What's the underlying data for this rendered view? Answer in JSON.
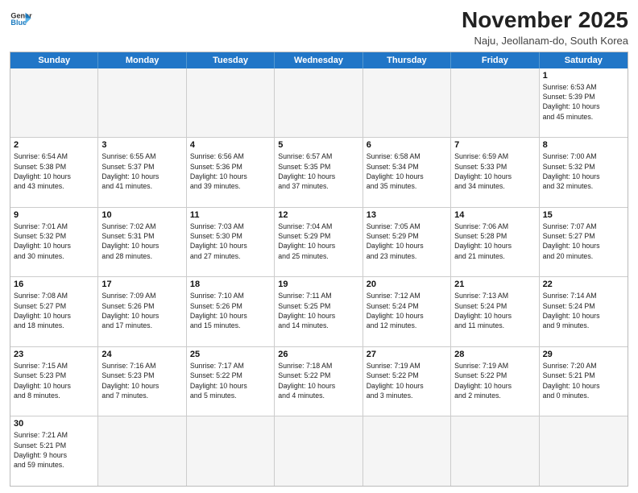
{
  "logo": {
    "line1": "General",
    "line2": "Blue"
  },
  "title": "November 2025",
  "subtitle": "Naju, Jeollanam-do, South Korea",
  "weekdays": [
    "Sunday",
    "Monday",
    "Tuesday",
    "Wednesday",
    "Thursday",
    "Friday",
    "Saturday"
  ],
  "weeks": [
    [
      {
        "day": "",
        "info": ""
      },
      {
        "day": "",
        "info": ""
      },
      {
        "day": "",
        "info": ""
      },
      {
        "day": "",
        "info": ""
      },
      {
        "day": "",
        "info": ""
      },
      {
        "day": "",
        "info": ""
      },
      {
        "day": "1",
        "info": "Sunrise: 6:53 AM\nSunset: 5:39 PM\nDaylight: 10 hours\nand 45 minutes."
      }
    ],
    [
      {
        "day": "2",
        "info": "Sunrise: 6:54 AM\nSunset: 5:38 PM\nDaylight: 10 hours\nand 43 minutes."
      },
      {
        "day": "3",
        "info": "Sunrise: 6:55 AM\nSunset: 5:37 PM\nDaylight: 10 hours\nand 41 minutes."
      },
      {
        "day": "4",
        "info": "Sunrise: 6:56 AM\nSunset: 5:36 PM\nDaylight: 10 hours\nand 39 minutes."
      },
      {
        "day": "5",
        "info": "Sunrise: 6:57 AM\nSunset: 5:35 PM\nDaylight: 10 hours\nand 37 minutes."
      },
      {
        "day": "6",
        "info": "Sunrise: 6:58 AM\nSunset: 5:34 PM\nDaylight: 10 hours\nand 35 minutes."
      },
      {
        "day": "7",
        "info": "Sunrise: 6:59 AM\nSunset: 5:33 PM\nDaylight: 10 hours\nand 34 minutes."
      },
      {
        "day": "8",
        "info": "Sunrise: 7:00 AM\nSunset: 5:32 PM\nDaylight: 10 hours\nand 32 minutes."
      }
    ],
    [
      {
        "day": "9",
        "info": "Sunrise: 7:01 AM\nSunset: 5:32 PM\nDaylight: 10 hours\nand 30 minutes."
      },
      {
        "day": "10",
        "info": "Sunrise: 7:02 AM\nSunset: 5:31 PM\nDaylight: 10 hours\nand 28 minutes."
      },
      {
        "day": "11",
        "info": "Sunrise: 7:03 AM\nSunset: 5:30 PM\nDaylight: 10 hours\nand 27 minutes."
      },
      {
        "day": "12",
        "info": "Sunrise: 7:04 AM\nSunset: 5:29 PM\nDaylight: 10 hours\nand 25 minutes."
      },
      {
        "day": "13",
        "info": "Sunrise: 7:05 AM\nSunset: 5:29 PM\nDaylight: 10 hours\nand 23 minutes."
      },
      {
        "day": "14",
        "info": "Sunrise: 7:06 AM\nSunset: 5:28 PM\nDaylight: 10 hours\nand 21 minutes."
      },
      {
        "day": "15",
        "info": "Sunrise: 7:07 AM\nSunset: 5:27 PM\nDaylight: 10 hours\nand 20 minutes."
      }
    ],
    [
      {
        "day": "16",
        "info": "Sunrise: 7:08 AM\nSunset: 5:27 PM\nDaylight: 10 hours\nand 18 minutes."
      },
      {
        "day": "17",
        "info": "Sunrise: 7:09 AM\nSunset: 5:26 PM\nDaylight: 10 hours\nand 17 minutes."
      },
      {
        "day": "18",
        "info": "Sunrise: 7:10 AM\nSunset: 5:26 PM\nDaylight: 10 hours\nand 15 minutes."
      },
      {
        "day": "19",
        "info": "Sunrise: 7:11 AM\nSunset: 5:25 PM\nDaylight: 10 hours\nand 14 minutes."
      },
      {
        "day": "20",
        "info": "Sunrise: 7:12 AM\nSunset: 5:24 PM\nDaylight: 10 hours\nand 12 minutes."
      },
      {
        "day": "21",
        "info": "Sunrise: 7:13 AM\nSunset: 5:24 PM\nDaylight: 10 hours\nand 11 minutes."
      },
      {
        "day": "22",
        "info": "Sunrise: 7:14 AM\nSunset: 5:24 PM\nDaylight: 10 hours\nand 9 minutes."
      }
    ],
    [
      {
        "day": "23",
        "info": "Sunrise: 7:15 AM\nSunset: 5:23 PM\nDaylight: 10 hours\nand 8 minutes."
      },
      {
        "day": "24",
        "info": "Sunrise: 7:16 AM\nSunset: 5:23 PM\nDaylight: 10 hours\nand 7 minutes."
      },
      {
        "day": "25",
        "info": "Sunrise: 7:17 AM\nSunset: 5:22 PM\nDaylight: 10 hours\nand 5 minutes."
      },
      {
        "day": "26",
        "info": "Sunrise: 7:18 AM\nSunset: 5:22 PM\nDaylight: 10 hours\nand 4 minutes."
      },
      {
        "day": "27",
        "info": "Sunrise: 7:19 AM\nSunset: 5:22 PM\nDaylight: 10 hours\nand 3 minutes."
      },
      {
        "day": "28",
        "info": "Sunrise: 7:19 AM\nSunset: 5:22 PM\nDaylight: 10 hours\nand 2 minutes."
      },
      {
        "day": "29",
        "info": "Sunrise: 7:20 AM\nSunset: 5:21 PM\nDaylight: 10 hours\nand 0 minutes."
      }
    ],
    [
      {
        "day": "30",
        "info": "Sunrise: 7:21 AM\nSunset: 5:21 PM\nDaylight: 9 hours\nand 59 minutes."
      },
      {
        "day": "",
        "info": ""
      },
      {
        "day": "",
        "info": ""
      },
      {
        "day": "",
        "info": ""
      },
      {
        "day": "",
        "info": ""
      },
      {
        "day": "",
        "info": ""
      },
      {
        "day": "",
        "info": ""
      }
    ]
  ]
}
